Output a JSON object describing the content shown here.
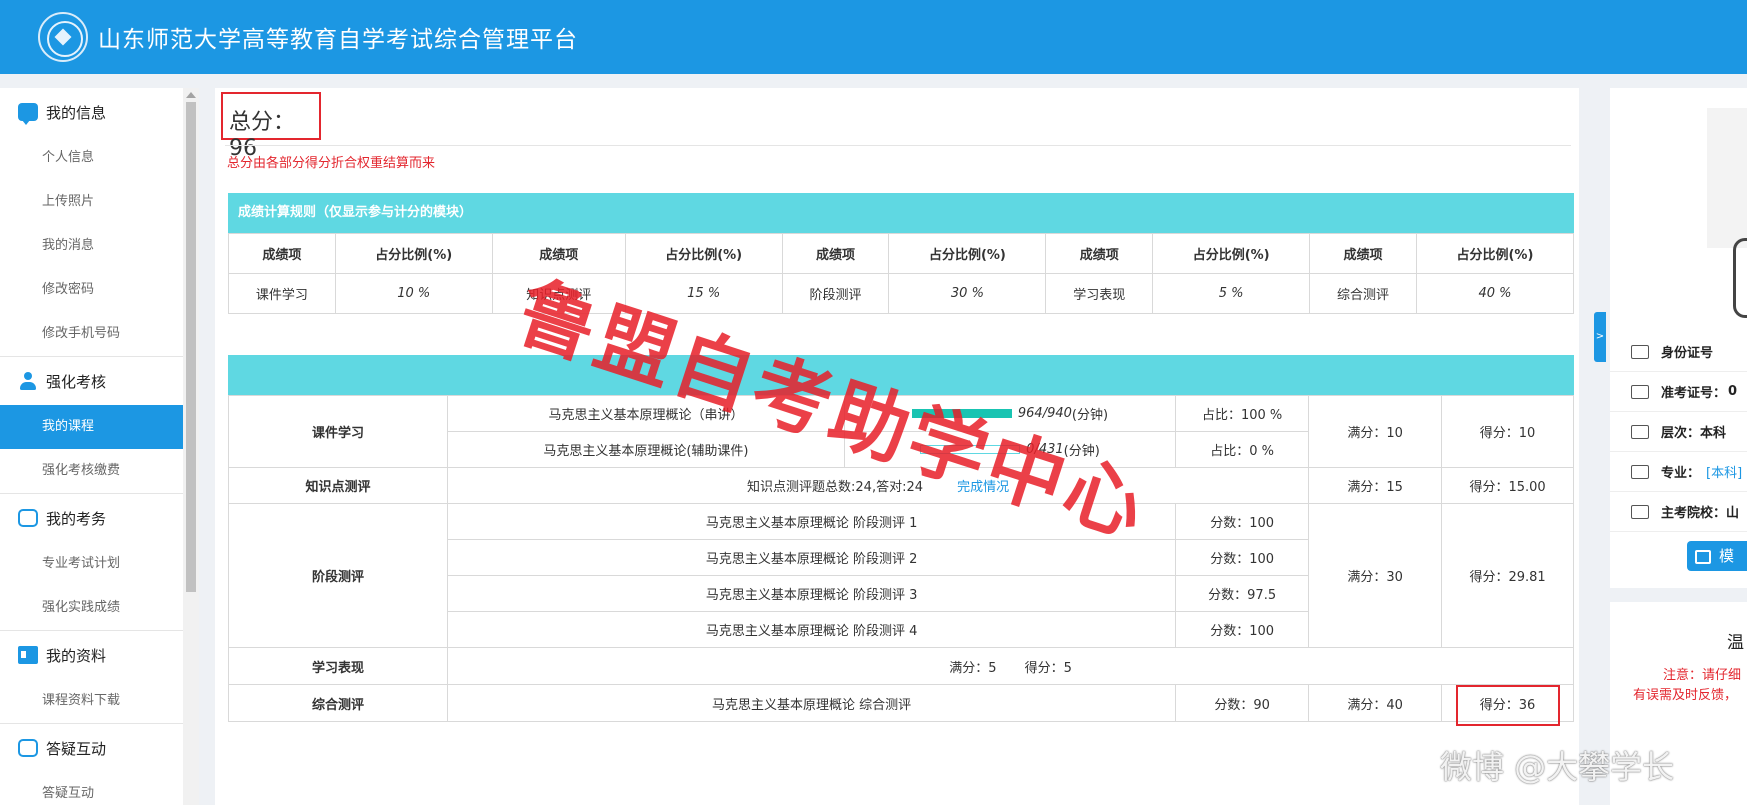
{
  "header": {
    "title": "山东师范大学高等教育自学考试综合管理平台"
  },
  "sidebar": {
    "groups": [
      {
        "title": "我的信息",
        "items": [
          "个人信息",
          "上传照片",
          "我的消息",
          "修改密码",
          "修改手机号码"
        ]
      },
      {
        "title": "强化考核",
        "items": [
          "我的课程",
          "强化考核缴费"
        ]
      },
      {
        "title": "我的考务",
        "items": [
          "专业考试计划",
          "强化实践成绩"
        ]
      },
      {
        "title": "我的资料",
        "items": [
          "课程资料下载"
        ]
      },
      {
        "title": "答疑互动",
        "items": [
          "答疑互动"
        ]
      }
    ],
    "active_item": "我的课程"
  },
  "main": {
    "total_label": "总分：",
    "total_value": "96",
    "note": "总分由各部分得分折合权重结算而来",
    "rules": {
      "title": "成绩计算规则（仅显示参与计分的模块）",
      "header_item": "成绩项",
      "header_ratio": "占分比例(%)",
      "rows": [
        {
          "name": "课件学习",
          "ratio": "10 %"
        },
        {
          "name": "知识点测评",
          "ratio": "15 %"
        },
        {
          "name": "阶段测评",
          "ratio": "30 %"
        },
        {
          "name": "学习表现",
          "ratio": "5 %"
        },
        {
          "name": "综合测评",
          "ratio": "40 %"
        }
      ]
    },
    "detail": {
      "courseware": {
        "label": "课件学习",
        "rows": [
          {
            "title": "马克思主义基本原理概论（串讲）",
            "progress": 1.0,
            "time": "964/940",
            "unit": "(分钟)",
            "share": "占比：100 %"
          },
          {
            "title": "马克思主义基本原理概论(辅助课件)",
            "progress": 0.0,
            "time": "0/431",
            "unit": "(分钟)",
            "share": "占比：0 %"
          }
        ],
        "full": "满分：10",
        "score": "得分：10"
      },
      "knowledge": {
        "label": "知识点测评",
        "text": "知识点测评题总数:24,答对:24",
        "link": "完成情况",
        "full": "满分：15",
        "score": "得分：15.00"
      },
      "stage": {
        "label": "阶段测评",
        "rows": [
          {
            "title": "马克思主义基本原理概论 阶段测评 1",
            "score": "分数：100"
          },
          {
            "title": "马克思主义基本原理概论 阶段测评 2",
            "score": "分数：100"
          },
          {
            "title": "马克思主义基本原理概论 阶段测评 3",
            "score": "分数：97.5"
          },
          {
            "title": "马克思主义基本原理概论 阶段测评 4",
            "score": "分数：100"
          }
        ],
        "full": "满分：30",
        "score": "得分：29.81"
      },
      "performance": {
        "label": "学习表现",
        "full": "满分：5",
        "score": "得分：5"
      },
      "comprehensive": {
        "label": "综合测评",
        "title": "马克思主义基本原理概论 综合测评",
        "exam_score": "分数：90",
        "full": "满分：40",
        "score": "得分：36"
      }
    }
  },
  "right_panel": {
    "collapse_glyph": ">",
    "info": [
      {
        "label": "身份证号",
        "value": ""
      },
      {
        "label": "准考证号：",
        "value": "0"
      },
      {
        "label": "层次：",
        "value": "本科"
      },
      {
        "label": "专业：",
        "value": "[本科]"
      },
      {
        "label": "主考院校：",
        "value": "山"
      }
    ],
    "mock_button": "模",
    "notice_title": "温",
    "notice_lines": [
      "注意：请仔细",
      "有误需及时反馈，"
    ]
  },
  "watermarks": {
    "main": "鲁盟自考助学中心",
    "weibo": "微博 @大攀学长"
  },
  "colors": {
    "brand": "#1c97e3",
    "accent_cyan": "#5fd8e2",
    "alert_red": "#e3262e"
  }
}
